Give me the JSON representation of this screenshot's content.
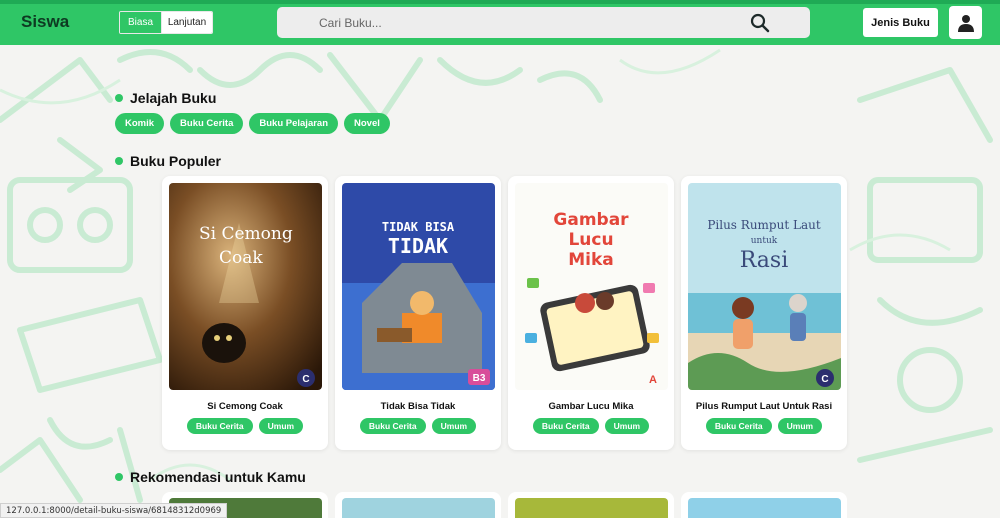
{
  "header": {
    "brand": "Siswa",
    "modes": [
      "Biasa",
      "Lanjutan"
    ],
    "search_placeholder": "Cari Buku...",
    "genre_button": "Jenis Buku"
  },
  "sections": {
    "explore": "Jelajah Buku",
    "popular": "Buku Populer",
    "recommend": "Rekomendasi untuk Kamu"
  },
  "categories": [
    "Komik",
    "Buku Cerita",
    "Buku Pelajaran",
    "Novel"
  ],
  "books": [
    {
      "title": "Si Cemong Coak",
      "tags": [
        "Buku Cerita",
        "Umum"
      ],
      "cover_text": [
        "Si Cemong",
        "Coak"
      ],
      "level": "C"
    },
    {
      "title": "Tidak Bisa Tidak",
      "tags": [
        "Buku Cerita",
        "Umum"
      ],
      "cover_text": [
        "TIDAK BISA",
        "TIDAK"
      ],
      "level": "B3"
    },
    {
      "title": "Gambar Lucu Mika",
      "tags": [
        "Buku Cerita",
        "Umum"
      ],
      "cover_text": [
        "Gambar",
        "Lucu",
        "Mika"
      ],
      "level": "A"
    },
    {
      "title": "Pilus Rumput Laut Untuk Rasi",
      "tags": [
        "Buku Cerita",
        "Umum"
      ],
      "cover_text": [
        "Pilus Rumput Laut",
        "untuk",
        "Rasi"
      ],
      "level": "C"
    }
  ],
  "status_url": "127.0.0.1:8000/detail-buku-siswa/68148312d0969",
  "colors": {
    "accent": "#2fc666",
    "background": "#f4f4f2"
  }
}
